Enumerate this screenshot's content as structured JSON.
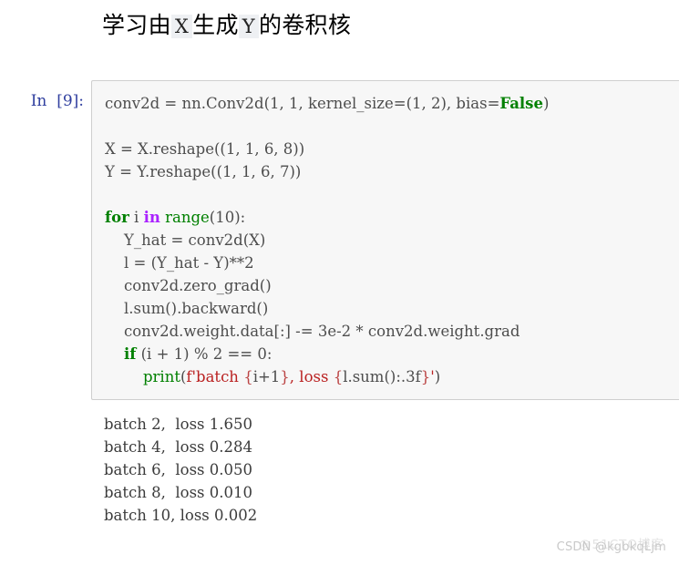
{
  "notebook": {
    "title": {
      "segment_1": "学习由",
      "code_x": "X",
      "segment_2": "生成",
      "code_y": "Y",
      "segment_3": "的卷积核"
    },
    "input_cell": {
      "prompt": "In  [9]:",
      "execution_count": "9",
      "code_lines": [
        "conv2d = nn.Conv2d(1, 1, kernel_size=(1, 2), bias=False)",
        "",
        "X = X.reshape((1, 1, 6, 8))",
        "Y = Y.reshape((1, 1, 6, 7))",
        "",
        "for i in range(10):",
        "    Y_hat = conv2d(X)",
        "    l = (Y_hat - Y)**2",
        "    conv2d.zero_grad()",
        "    l.sum().backward()",
        "    conv2d.weight.data[:] -= 3e-2 * conv2d.weight.grad",
        "    if (i + 1) % 2 == 0:",
        "        print(f'batch {i+1}, loss {l.sum():.3f}')"
      ],
      "tokens": {
        "line1_a": "conv2d = nn.Conv2d(1, 1, kernel_size=(1, 2), bias=",
        "line1_false": "False",
        "line1_b": ")",
        "line3": "X = X.reshape((1, 1, 6, 8))",
        "line4": "Y = Y.reshape((1, 1, 6, 7))",
        "line6_for": "for",
        "line6_i": " i ",
        "line6_in": "in",
        "line6_range": " range",
        "line6_tail": "(10):",
        "line7": "    Y_hat = conv2d(X)",
        "line8": "    l = (Y_hat - Y)**2",
        "line9": "    conv2d.zero_grad()",
        "line10": "    l.sum().backward()",
        "line11": "    conv2d.weight.data[:] -= 3e-2 * conv2d.weight.grad",
        "line12_indent": "    ",
        "line12_if": "if",
        "line12_tail": " (i + 1) % 2 == 0:",
        "line13_indent": "        ",
        "line13_print": "print",
        "line13_open": "(",
        "line13_fprefix": "f'batch ",
        "line13_brace1_open": "{",
        "line13_expr1": "i+1",
        "line13_brace1_close": "}",
        "line13_mid": ", loss ",
        "line13_brace2_open": "{",
        "line13_expr2": "l.sum():.3f",
        "line13_brace2_close": "}",
        "line13_quote": "'",
        "line13_close": ")"
      }
    },
    "output_cell": {
      "lines": [
        "batch 2, loss 1.650",
        "batch 4, loss 0.284",
        "batch 6, loss 0.050",
        "batch 8, loss 0.010",
        "batch 10, loss 0.002"
      ],
      "text": "batch 2,  loss 1.650\nbatch 4,  loss 0.284\nbatch 6,  loss 0.050\nbatch 8,  loss 0.010\nbatch 10, loss 0.002"
    },
    "watermarks": {
      "primary": "CSDN @kgbkqLjm",
      "secondary": "@51CTO博客"
    },
    "colors": {
      "prompt_blue": "#303f9f",
      "cell_background": "#f7f7f7",
      "cell_border": "#cfcfcf",
      "keyword_green": "#008000",
      "operator_purple": "#aa22ff",
      "string_red": "#ba2121",
      "code_text": "#4d4d4d",
      "inline_code_background": "#eef0f3"
    }
  }
}
